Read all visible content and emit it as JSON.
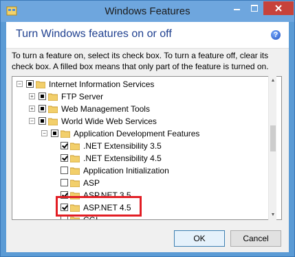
{
  "window": {
    "title": "Windows Features"
  },
  "header": {
    "heading": "Turn Windows features on or off"
  },
  "instructions": "To turn a feature on, select its check box. To turn a feature off, clear its check box. A filled box means that only part of the feature is turned on.",
  "tree": {
    "items": [
      {
        "label": "Internet Information Services",
        "state": "partial",
        "expander": "−"
      },
      {
        "label": "FTP Server",
        "state": "partial",
        "expander": "+"
      },
      {
        "label": "Web Management Tools",
        "state": "partial",
        "expander": "+"
      },
      {
        "label": "World Wide Web Services",
        "state": "partial",
        "expander": "−"
      },
      {
        "label": "Application Development Features",
        "state": "partial",
        "expander": "−"
      },
      {
        "label": ".NET Extensibility 3.5",
        "state": "checked"
      },
      {
        "label": ".NET Extensibility 4.5",
        "state": "checked"
      },
      {
        "label": "Application Initialization",
        "state": "unchecked"
      },
      {
        "label": "ASP",
        "state": "unchecked"
      },
      {
        "label": "ASP.NET 3.5",
        "state": "checked"
      },
      {
        "label": "ASP.NET 4.5",
        "state": "checked"
      },
      {
        "label": "CGI",
        "state": "unchecked"
      }
    ]
  },
  "buttons": {
    "ok": "OK",
    "cancel": "Cancel"
  },
  "colors": {
    "accent": "#5b9bd5",
    "highlight": "#e21d24",
    "heading": "#1e3f8f"
  }
}
